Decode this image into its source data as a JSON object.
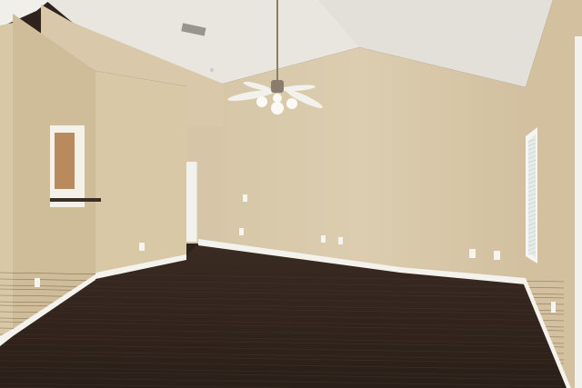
{
  "scene": {
    "name": "empty-room-with-ceiling-fan",
    "colors": {
      "ceiling_left": "#e9e6df",
      "ceiling_right": "#e2e0d9",
      "ceiling_top": "#f1efe9",
      "wall_back": "#d6c6a7",
      "wall_left_front": "#cfbd9a",
      "wall_left_side": "#d8c8a6",
      "wall_right": "#d2c09f",
      "wall_upper": "#d9c9aa",
      "floor": "#3a2b22",
      "floor_grain": "#4a382d",
      "baseboard": "#f4f2ec",
      "door": "#f2f1ed",
      "window_frame": "#f5f5f1",
      "window_blinds": "#e6ebe7",
      "fan_blade": "#f3f1ec",
      "fan_metal": "#8a7d6b",
      "shelf_wood": "#b98a5d"
    }
  }
}
